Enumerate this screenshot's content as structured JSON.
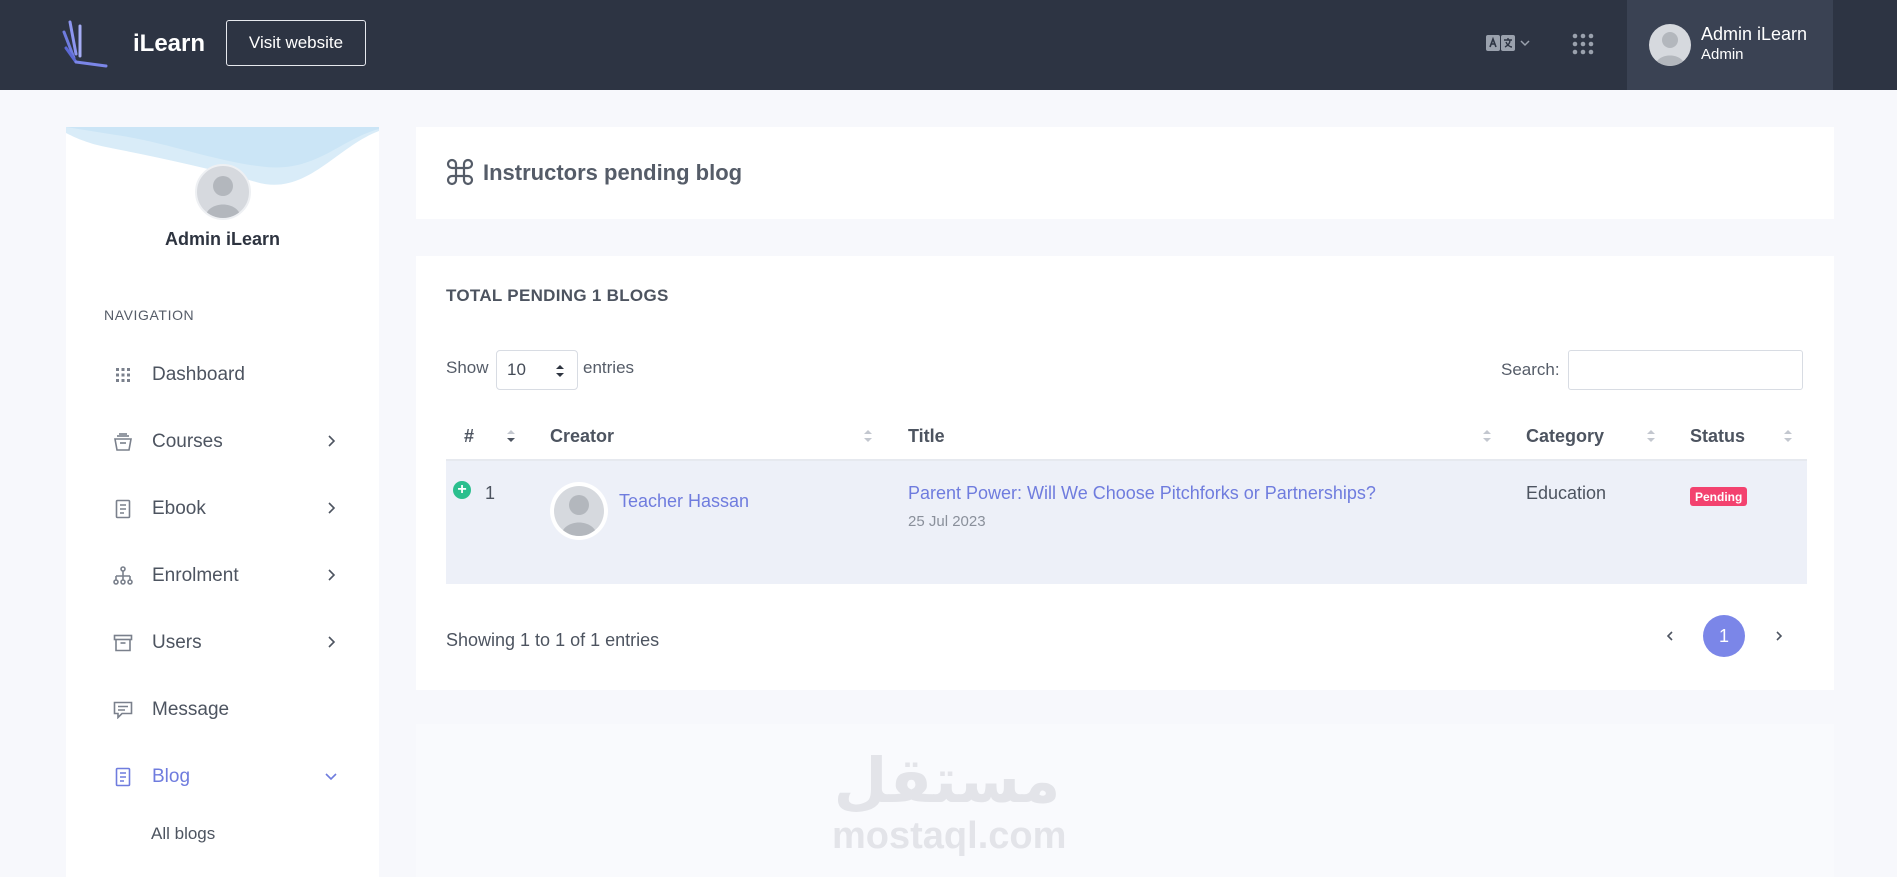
{
  "header": {
    "brand": "iLearn",
    "visit_button": "Visit website",
    "user_name": "Admin iLearn",
    "user_role": "Admin"
  },
  "sidebar": {
    "profile_name": "Admin iLearn",
    "nav_heading": "NAVIGATION",
    "items": [
      {
        "label": "Dashboard",
        "icon": "grid-icon"
      },
      {
        "label": "Courses",
        "icon": "courses-icon"
      },
      {
        "label": "Ebook",
        "icon": "book-icon"
      },
      {
        "label": "Enrolment",
        "icon": "sitemap-icon"
      },
      {
        "label": "Users",
        "icon": "archive-icon"
      },
      {
        "label": "Message",
        "icon": "message-icon"
      },
      {
        "label": "Blog",
        "icon": "document-icon"
      }
    ],
    "blog_subitems": [
      {
        "label": "All blogs"
      }
    ]
  },
  "page": {
    "title": "Instructors pending blog"
  },
  "table_card": {
    "heading": "TOTAL PENDING 1 BLOGS",
    "show_label": "Show",
    "page_length": "10",
    "entries_label": "entries",
    "search_label": "Search:",
    "search_value": "",
    "columns": [
      "#",
      "Creator",
      "Title",
      "Category",
      "Status"
    ],
    "rows": [
      {
        "index": "1",
        "creator": "Teacher Hassan",
        "title": "Parent Power: Will We Choose Pitchforks or Partnerships?",
        "date": "25 Jul 2023",
        "category": "Education",
        "status": "Pending"
      }
    ],
    "info": "Showing 1 to 1 of 1 entries",
    "current_page": "1"
  },
  "watermark": {
    "arabic": "مستقل",
    "latin": "mostaql.com"
  },
  "colors": {
    "topbar": "#2d3443",
    "accent": "#6f7cde",
    "pending": "#f3426f",
    "expand": "#2bbf8e"
  }
}
